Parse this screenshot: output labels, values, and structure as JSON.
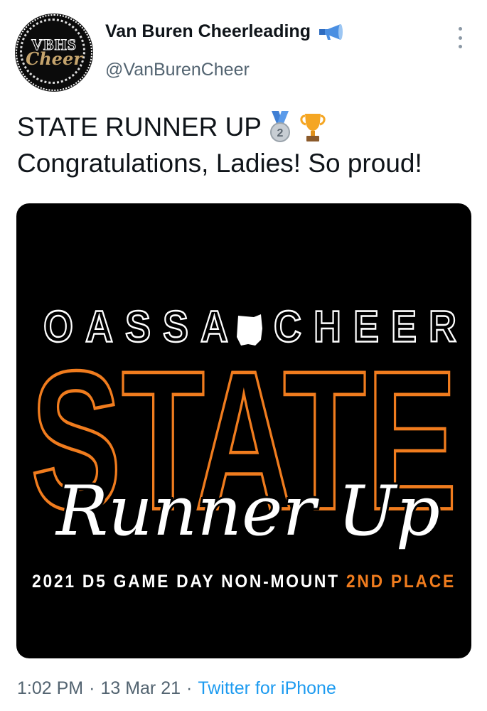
{
  "tweet": {
    "author": {
      "name": "Van Buren Cheerleading",
      "handle": "@VanBurenCheer",
      "name_icon": "megaphone-icon"
    },
    "avatar": {
      "top_text": "VBHS",
      "script_text": "Cheer"
    },
    "text_line1": "STATE RUNNER UP",
    "text_line1_icons": [
      "second-place-medal-icon",
      "trophy-icon"
    ],
    "text_line2": "Congratulations, Ladies! So proud!",
    "media": {
      "line1": "OASSA CHEER",
      "state_word": "STATE",
      "script": "Runner Up",
      "footer_white": "2021 D5 GAME DAY NON-MOUNT",
      "footer_orange": "2ND PLACE"
    },
    "meta": {
      "time": "1:02 PM",
      "date": "13 Mar 21",
      "separator": "·",
      "source": "Twitter for iPhone"
    }
  },
  "colors": {
    "orange": "#f07c1e",
    "link": "#1d9bf0",
    "secondary": "#536471"
  }
}
